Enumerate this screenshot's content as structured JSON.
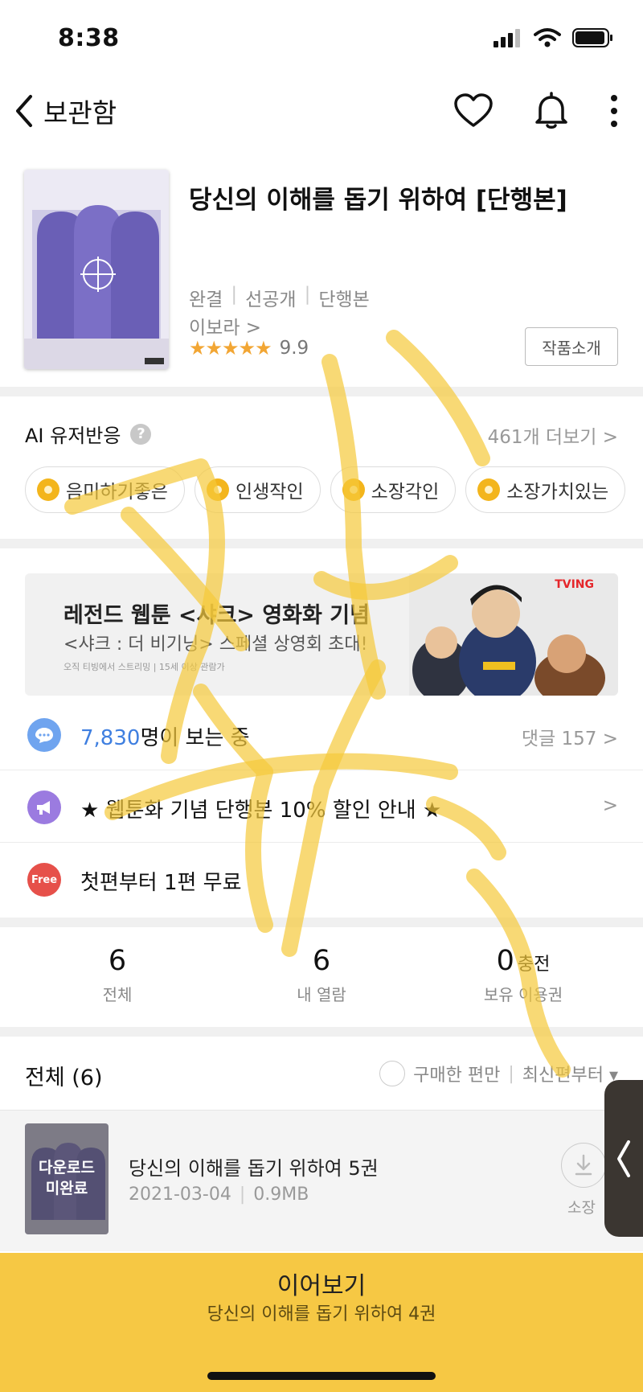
{
  "status_bar": {
    "time": "8:38",
    "icons": [
      "cellular-signal-icon",
      "wifi-icon",
      "battery-icon"
    ]
  },
  "nav": {
    "back_label": "보관함",
    "icons": [
      "chevron-left-icon",
      "heart-icon",
      "bell-icon",
      "more-vertical-icon"
    ]
  },
  "book": {
    "title": "당신의 이해를 돕기 위하여 [단행본]",
    "meta": [
      "완결",
      "선공개",
      "단행본"
    ],
    "author": "이보라 >",
    "stars": "★★★★★",
    "rating": "9.9",
    "intro_button": "작품소개"
  },
  "ai_reactions": {
    "label": "AI 유저반응",
    "help": "?",
    "more": "461개 더보기 >",
    "chips": [
      "음미하기좋은",
      "인생작인",
      "소장각인",
      "소장가치있는"
    ]
  },
  "banner": {
    "title": "레전드 웹툰 <샤크> 영화화 기념",
    "subtitle": "<샤크 : 더 비기닝> 스페셜 상영회 초대!",
    "note": "오직 티빙에서 스트리밍 | 15세 이상 관람가",
    "brand": "TVING"
  },
  "rows": {
    "viewers_count": "7,830",
    "viewers_suffix": "명이 보는 중",
    "comments": "댓글 157 >",
    "promo": "★ 웹툰화 기념 단행본 10% 할인 안내 ★",
    "promo_arrow": ">",
    "free_badge": "Free",
    "free_text": "첫편부터 1편 무료"
  },
  "stats": {
    "total_value": "6",
    "total_label": "전체",
    "read_value": "6",
    "read_label": "내 열람",
    "ticket_value": "0",
    "ticket_action": "충전",
    "ticket_label": "보유 이용권"
  },
  "list": {
    "title": "전체 (6)",
    "filter_label": "구매한 편만",
    "sort_label": "최신편부터 ▾"
  },
  "episode": {
    "thumb_overlay_line1": "다운로드",
    "thumb_overlay_line2": "미완료",
    "title": "당신의 이해를 돕기 위하여 5권",
    "date": "2021-03-04",
    "size": "0.9MB",
    "download_label": "소장"
  },
  "cta": {
    "title": "이어보기",
    "subtitle": "당신의 이해를 돕기 위하여 4권"
  },
  "colors": {
    "accent_yellow": "#f6c844",
    "star": "#f2a634",
    "viewer_blue": "#3f7fe0",
    "free_red": "#e6504a",
    "promo_purple": "#9b7be0",
    "chat_blue": "#6fa4ef"
  }
}
